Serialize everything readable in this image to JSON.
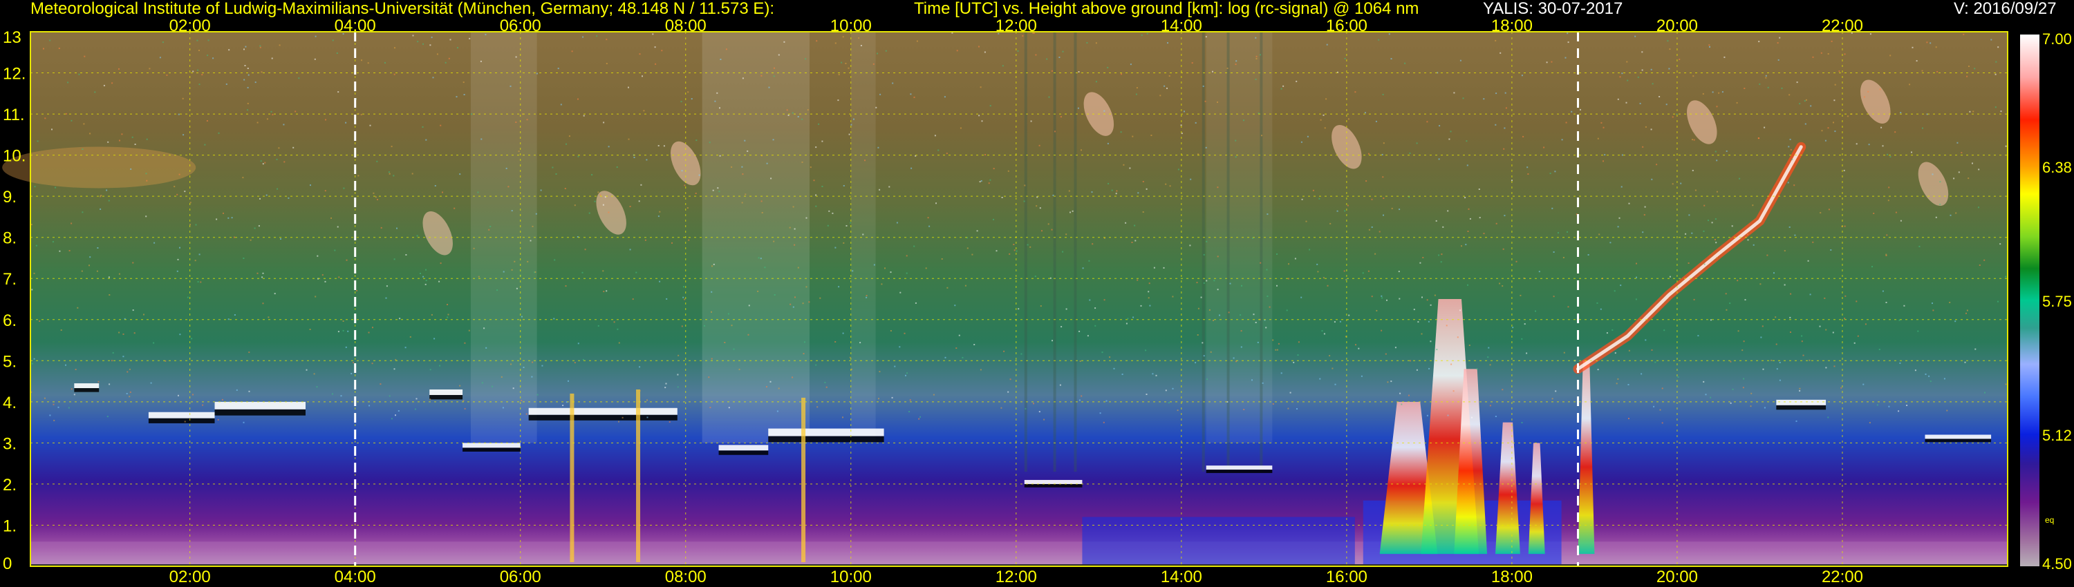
{
  "header": {
    "institute": "Meteorological Institute of Ludwig-Maximilians-Universität (München, Germany; 48.148 N / 11.573 E):",
    "description": "Time [UTC] vs. Height above ground [km]: log (rc-signal) @ 1064 nm",
    "station_date": "YALIS: 30-07-2017",
    "version": "V: 2016/09/27"
  },
  "colors": {
    "label_text": "#ffff00",
    "grid": "#e6e600",
    "marker": "#ffffff",
    "background": "#000000"
  },
  "chart_data": {
    "type": "heatmap",
    "x_ticks": [
      {
        "value": 2,
        "label": "02:00"
      },
      {
        "value": 4,
        "label": "04:00"
      },
      {
        "value": 6,
        "label": "06:00"
      },
      {
        "value": 8,
        "label": "08:00"
      },
      {
        "value": 10,
        "label": "10:00"
      },
      {
        "value": 12,
        "label": "12:00"
      },
      {
        "value": 14,
        "label": "14:00"
      },
      {
        "value": 16,
        "label": "16:00"
      },
      {
        "value": 18,
        "label": "18:00"
      },
      {
        "value": 20,
        "label": "20:00"
      },
      {
        "value": 22,
        "label": "22:00"
      }
    ],
    "xlim": [
      0.07,
      24
    ],
    "y_ticks": [
      {
        "value": 0,
        "label": "0"
      },
      {
        "value": 1,
        "label": "1."
      },
      {
        "value": 2,
        "label": "2."
      },
      {
        "value": 3,
        "label": "3."
      },
      {
        "value": 4,
        "label": "4."
      },
      {
        "value": 5,
        "label": "5."
      },
      {
        "value": 6,
        "label": "6."
      },
      {
        "value": 7,
        "label": "7."
      },
      {
        "value": 8,
        "label": "8."
      },
      {
        "value": 9,
        "label": "9."
      },
      {
        "value": 10,
        "label": "10."
      },
      {
        "value": 11,
        "label": "11."
      },
      {
        "value": 12,
        "label": "12."
      },
      {
        "value": 13,
        "label": "13"
      }
    ],
    "ylim": [
      0,
      13
    ],
    "grid": true,
    "markers_x": [
      4.0,
      18.8
    ],
    "colorbar": {
      "min": 4.5,
      "max": 7.0,
      "ticks": [
        {
          "value": 7.0,
          "label": "7.00"
        },
        {
          "value": 6.38,
          "label": "6.38"
        },
        {
          "value": 5.75,
          "label": "5.75"
        },
        {
          "value": 5.12,
          "label": "5.12"
        },
        {
          "value": 4.5,
          "label": "4.50"
        }
      ],
      "small_label": "eq",
      "small_label_value": 4.72,
      "stops": [
        {
          "v": 4.5,
          "c": "#b8b0b8"
        },
        {
          "v": 4.62,
          "c": "#a070a0"
        },
        {
          "v": 4.8,
          "c": "#701a90"
        },
        {
          "v": 4.98,
          "c": "#301a9a"
        },
        {
          "v": 5.12,
          "c": "#0a20e0"
        },
        {
          "v": 5.3,
          "c": "#4a78ff"
        },
        {
          "v": 5.45,
          "c": "#9ab0ff"
        },
        {
          "v": 5.62,
          "c": "#30a090"
        },
        {
          "v": 5.75,
          "c": "#00c890"
        },
        {
          "v": 5.9,
          "c": "#0a8a20"
        },
        {
          "v": 6.05,
          "c": "#80d820"
        },
        {
          "v": 6.25,
          "c": "#ffff00"
        },
        {
          "v": 6.38,
          "c": "#ffa000"
        },
        {
          "v": 6.6,
          "c": "#ff2000"
        },
        {
          "v": 6.8,
          "c": "#ffa8a8"
        },
        {
          "v": 7.0,
          "c": "#ffffff"
        }
      ]
    }
  }
}
